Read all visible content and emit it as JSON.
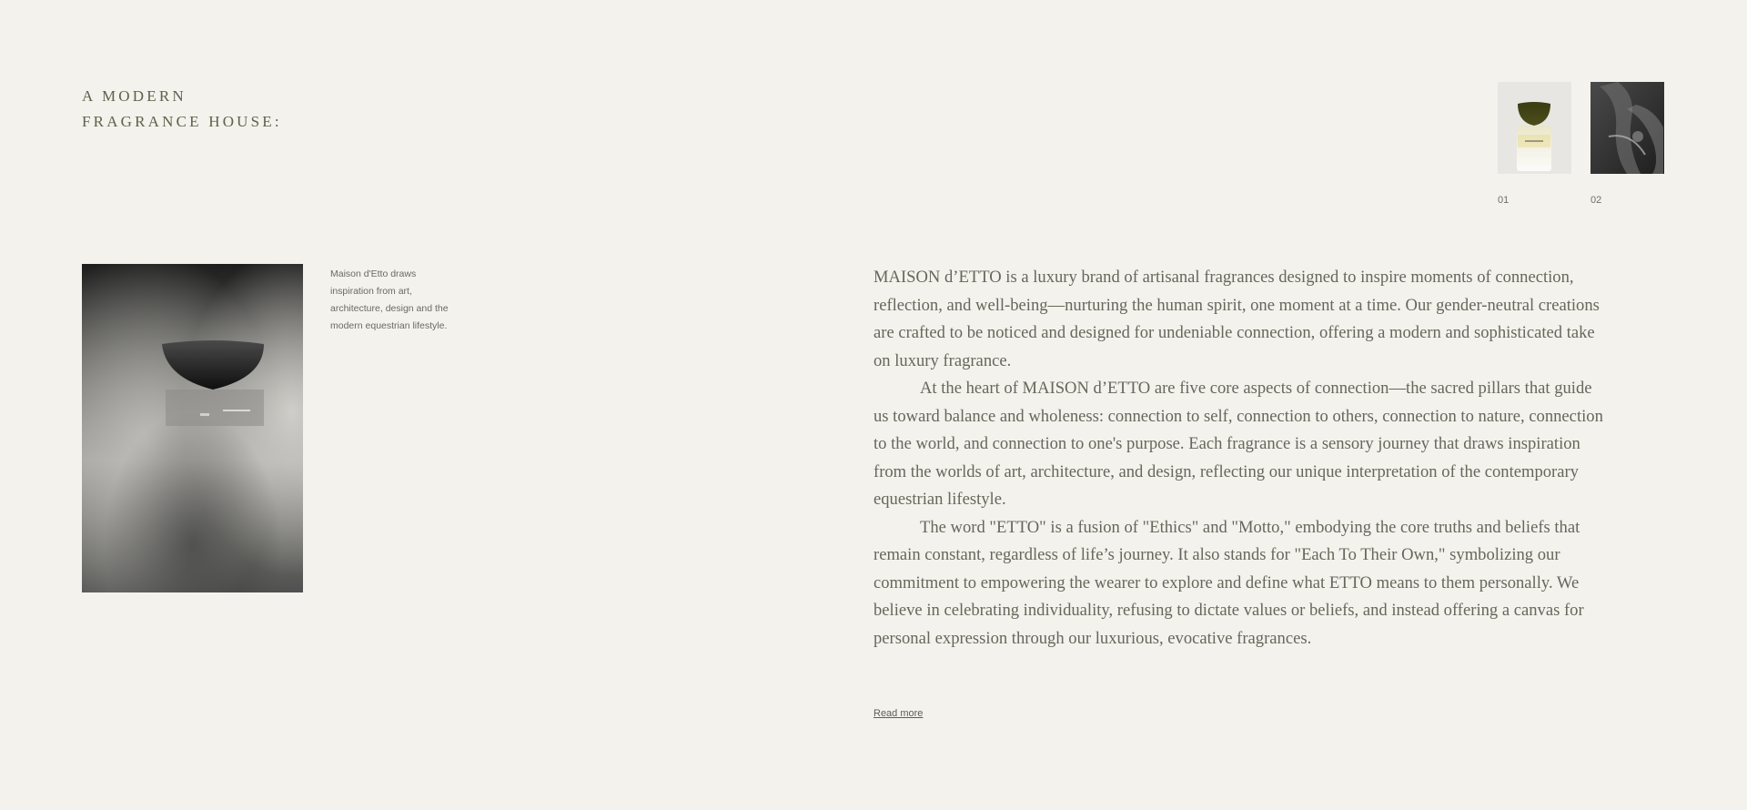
{
  "heading": {
    "line1": "A MODERN",
    "line2": "FRAGRANCE HOUSE:"
  },
  "thumbnails": [
    {
      "number": "01",
      "icon": "perfume-bottle-image"
    },
    {
      "number": "02",
      "icon": "equestrian-image"
    }
  ],
  "hero": {
    "icon": "perfume-bottle-image",
    "caption": "Maison d'Etto draws inspiration from art, architecture, design and the modern equestrian lifestyle."
  },
  "about": {
    "paragraphs": [
      "MAISON d’ETTO is a luxury brand of artisanal fragrances designed to inspire moments of connection, reflection, and well-being—nurturing the human spirit, one moment at a time. Our gender-neutral creations are crafted to be noticed and designed for undeniable connection, offering a modern and sophisticated take on luxury fragrance.",
      "At the heart of MAISON d’ETTO are five core aspects of connection—the sacred pillars that guide us toward balance and wholeness: connection to self, connection to others, connection to nature, connection to the world, and connection to one's purpose. Each fragrance is a sensory journey that draws inspiration from the worlds of art, architecture, and design, reflecting our unique interpretation of the contemporary equestrian lifestyle.",
      "The word \"ETTO\" is a fusion of \"Ethics\" and \"Motto,\" embodying the core truths and beliefs that remain constant, regardless of life’s journey. It also stands for \"Each To Their Own,\" symbolizing our commitment to empowering the wearer to explore and define what ETTO means to them personally. We believe in celebrating individuality, refusing to dictate values or beliefs, and instead offering a canvas for personal expression through our luxurious, evocative fragrances."
    ],
    "read_more": "Read more"
  },
  "colors": {
    "background": "#f3f2ed",
    "heading": "#5f6149",
    "text": "#66675a"
  }
}
